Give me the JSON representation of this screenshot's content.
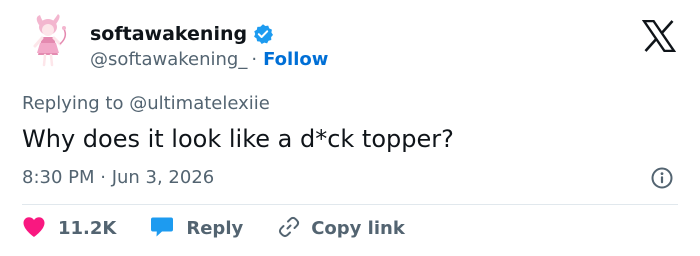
{
  "author": {
    "display_name": "softawakening",
    "handle": "@softawakening_",
    "separator": "·",
    "follow_label": "Follow",
    "verified": true
  },
  "tweet": {
    "replying_to": "Replying to @ultimatelexiie",
    "text": "Why does it look like a d*ck topper?",
    "timestamp": "8:30 PM · Jun 3, 2026"
  },
  "actions": {
    "like_count": "11.2K",
    "reply_label": "Reply",
    "copy_link_label": "Copy link"
  },
  "icons": {
    "brand": "x-logo-icon",
    "verified": "verified-badge-icon",
    "info": "info-icon",
    "like": "heart-icon",
    "reply": "reply-bubble-icon",
    "copy_link": "link-icon"
  },
  "colors": {
    "text_primary": "#0f1419",
    "text_secondary": "#536471",
    "accent_blue": "#1d9bf0",
    "follow_blue": "#006fd6",
    "like_red": "#f91880",
    "divider": "#e1e8ed"
  }
}
